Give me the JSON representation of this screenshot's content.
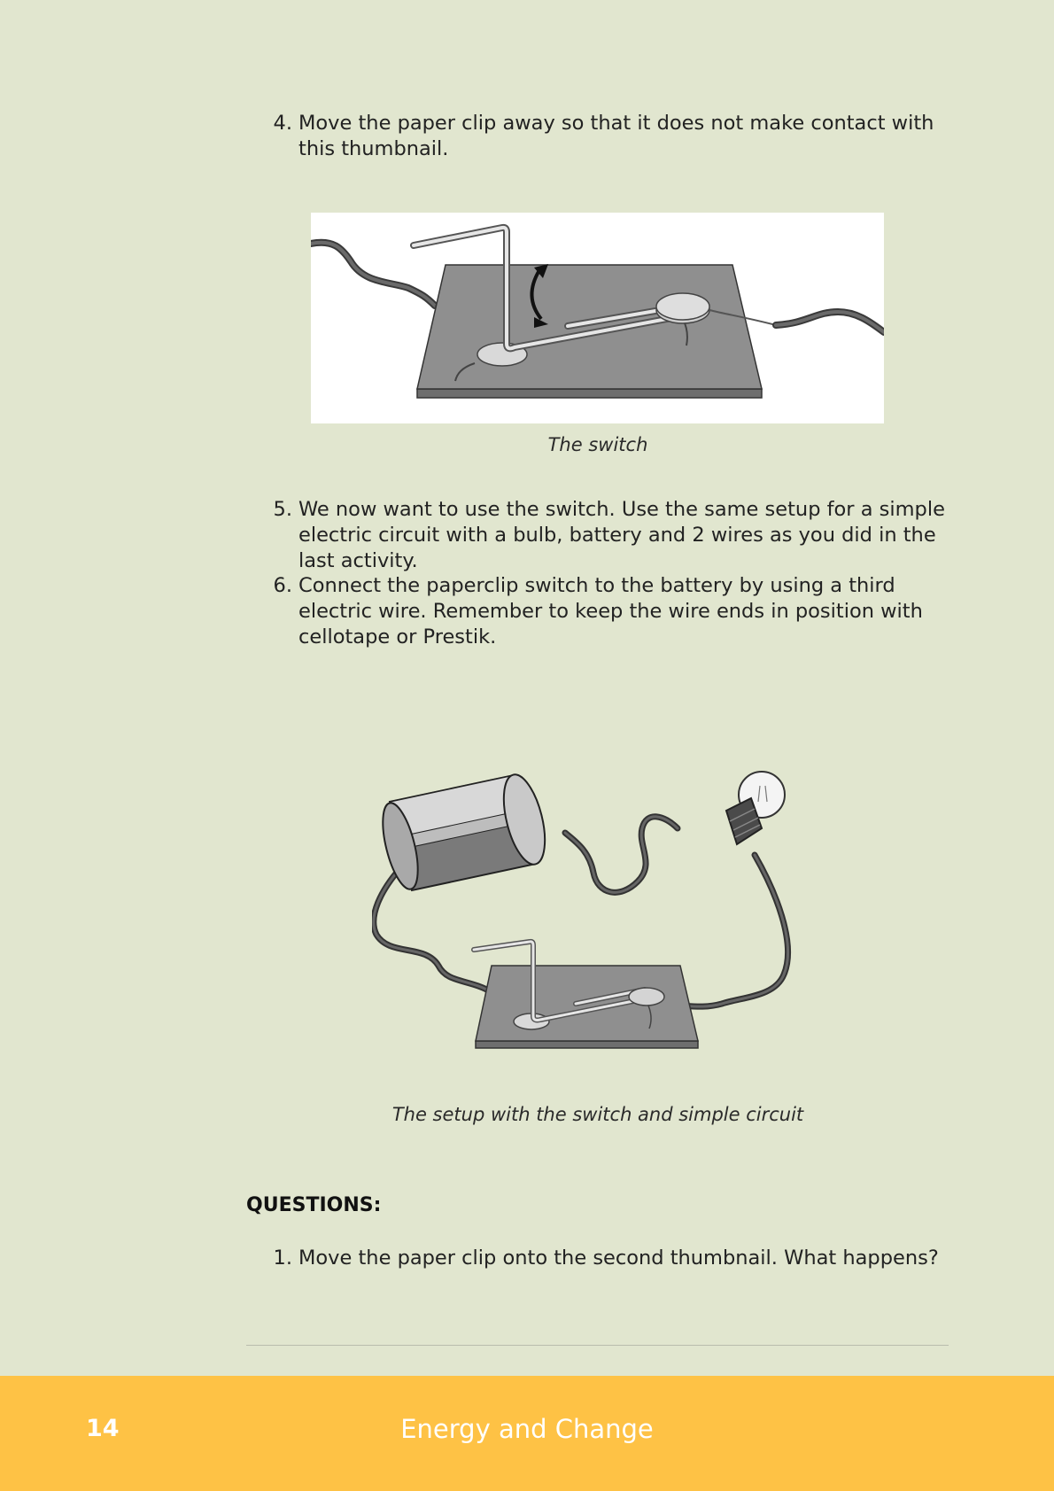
{
  "steps_top": [
    {
      "number": "4.",
      "text": "Move the paper clip away so that it does not make contact with this thumbnail."
    }
  ],
  "figure1": {
    "caption": "The switch"
  },
  "steps_mid": [
    {
      "number": "5.",
      "text": "We now want to use the switch. Use the same setup for a simple electric circuit with a bulb, battery and 2 wires as you did in the last activity."
    },
    {
      "number": "6.",
      "text": "Connect the paperclip switch to the battery by using a third electric wire. Remember to keep the wire ends in position with cellotape or Prestik."
    }
  ],
  "figure2": {
    "caption": "The setup with the switch and simple circuit"
  },
  "questions": {
    "heading": "QUESTIONS:",
    "items": [
      {
        "number": "1.",
        "text": "Move the paper clip onto the second thumbnail. What happens?"
      }
    ]
  },
  "footer": {
    "page_number": "14",
    "title": "Energy and Change"
  },
  "colors": {
    "page_background": "#e1e6cf",
    "footer_band": "#fec245",
    "board": "#8f8f8f"
  }
}
